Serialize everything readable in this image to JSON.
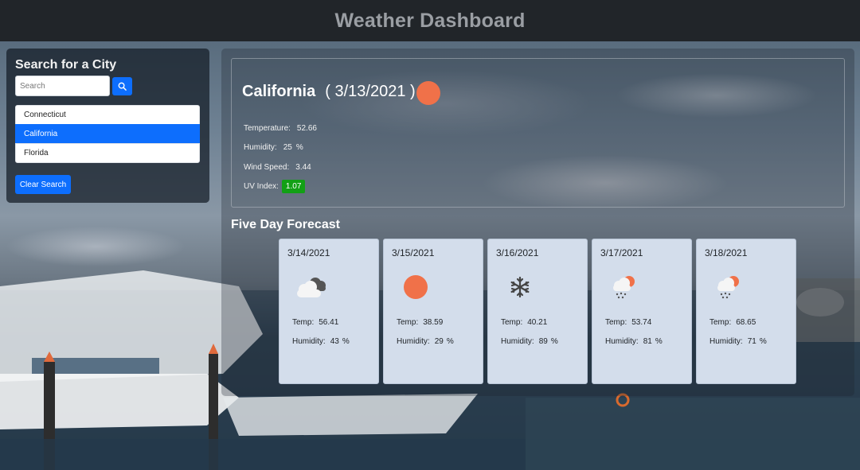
{
  "header": {
    "title": "Weather Dashboard"
  },
  "search": {
    "heading": "Search for a City",
    "placeholder": "Search",
    "value": "",
    "button_icon": "search-icon",
    "cities": [
      "Connecticut",
      "California",
      "Florida"
    ],
    "active_city": "California",
    "clear_label": "Clear Search"
  },
  "current": {
    "city": "California",
    "date": "( 3/13/2021 )",
    "icon": "sun-icon",
    "temperature_label": "Temperature:",
    "temperature": "52.66",
    "humidity_label": "Humidity:",
    "humidity": "25",
    "humidity_unit": "%",
    "wind_label": "Wind Speed:",
    "wind": "3.44",
    "uv_label": "UV Index:",
    "uv": "1.07",
    "uv_color": "#12a015"
  },
  "forecast": {
    "title": "Five Day Forecast",
    "temp_label": "Temp:",
    "humidity_label": "Humidity:",
    "humidity_unit": "%",
    "days": [
      {
        "date": "3/14/2021",
        "icon": "cloudy-icon",
        "temp": "56.41",
        "humidity": "43"
      },
      {
        "date": "3/15/2021",
        "icon": "sun-icon",
        "temp": "38.59",
        "humidity": "29"
      },
      {
        "date": "3/16/2021",
        "icon": "snowflake-icon",
        "temp": "40.21",
        "humidity": "89"
      },
      {
        "date": "3/17/2021",
        "icon": "rain-sun-icon",
        "temp": "53.74",
        "humidity": "81"
      },
      {
        "date": "3/18/2021",
        "icon": "rain-sun-icon",
        "temp": "68.65",
        "humidity": "71"
      }
    ]
  },
  "colors": {
    "accent": "#0d6efd",
    "sun": "#f07149",
    "card_bg": "#d3ddeb",
    "navbar": "#212529"
  }
}
